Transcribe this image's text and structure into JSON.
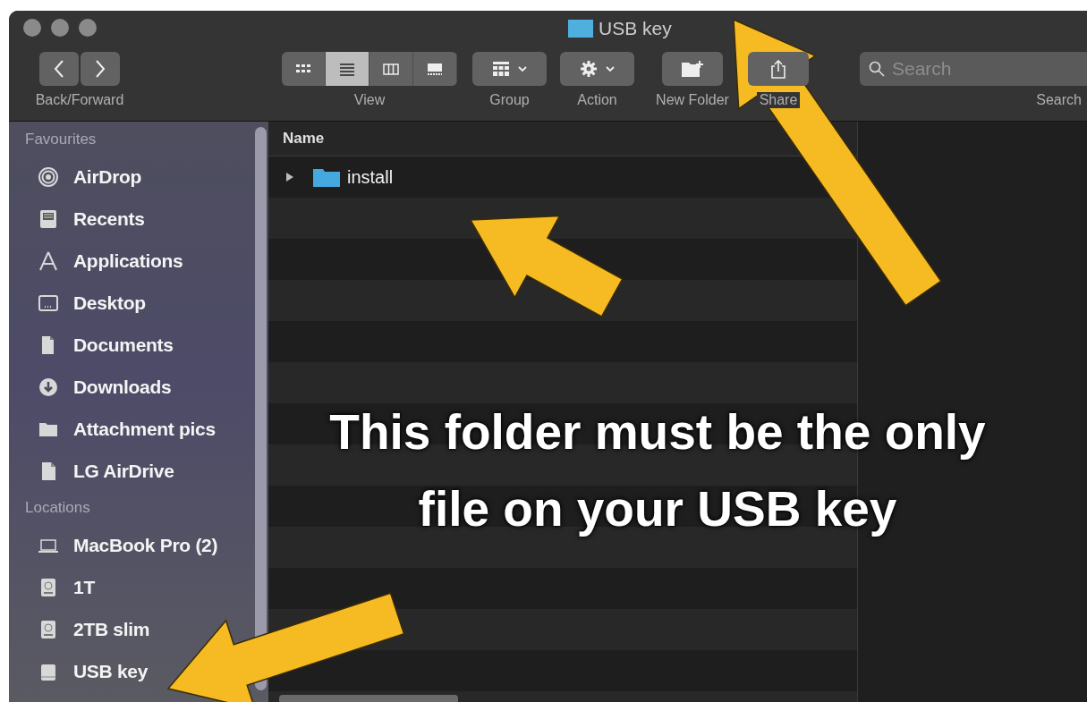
{
  "window": {
    "title": "USB key"
  },
  "toolbar": {
    "back_forward": {
      "label": "Back/Forward"
    },
    "view": {
      "label": "View",
      "modes": [
        {
          "kind": "icons",
          "selected": false
        },
        {
          "kind": "list",
          "selected": true
        },
        {
          "kind": "columns",
          "selected": false
        },
        {
          "kind": "gallery",
          "selected": false
        }
      ]
    },
    "group": {
      "label": "Group"
    },
    "action": {
      "label": "Action"
    },
    "new_folder": {
      "label": "New Folder"
    },
    "share": {
      "label": "Share"
    },
    "search": {
      "placeholder": "Search",
      "label": "Search"
    }
  },
  "sidebar": {
    "sections": [
      {
        "title": "Favourites",
        "items": [
          {
            "label": "AirDrop",
            "kind": "airdrop"
          },
          {
            "label": "Recents",
            "kind": "recents"
          },
          {
            "label": "Applications",
            "kind": "applications"
          },
          {
            "label": "Desktop",
            "kind": "desktop"
          },
          {
            "label": "Documents",
            "kind": "documents"
          },
          {
            "label": "Downloads",
            "kind": "downloads"
          },
          {
            "label": "Attachment pics",
            "kind": "folder"
          },
          {
            "label": "LG AirDrive",
            "kind": "file"
          }
        ]
      },
      {
        "title": "Locations",
        "items": [
          {
            "label": "MacBook Pro (2)",
            "kind": "laptop"
          },
          {
            "label": "1T",
            "kind": "disk"
          },
          {
            "label": "2TB slim",
            "kind": "disk"
          },
          {
            "label": "USB key",
            "kind": "drive"
          }
        ]
      }
    ]
  },
  "file_list": {
    "columns": [
      "Name"
    ],
    "rows": [
      {
        "name": "install",
        "expanded": false
      }
    ]
  },
  "annotation": {
    "text": "This folder must be the only file on your USB key"
  }
}
